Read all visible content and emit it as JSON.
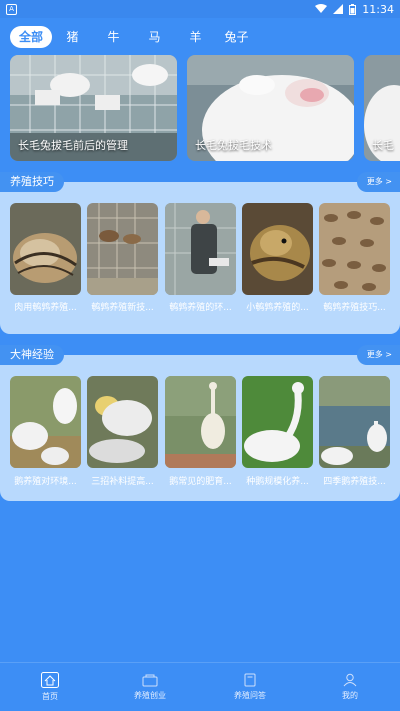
{
  "status": {
    "time": "11:34",
    "app_icon": "A"
  },
  "categories": [
    "全部",
    "猪",
    "牛",
    "马",
    "羊",
    "兔子"
  ],
  "banners": [
    {
      "caption": "长毛兔拔毛前后的管理"
    },
    {
      "caption": "长毛兔拔毛技术"
    },
    {
      "caption": "长毛"
    }
  ],
  "section1": {
    "title": "养殖技巧",
    "more": "更多 >",
    "items": [
      "肉用鹌鹑养殖...",
      "鹌鹑养殖新技...",
      "鹌鹑养殖的环...",
      "小鹌鹑养殖的...",
      "鹌鹑养殖技巧..."
    ]
  },
  "section2": {
    "title": "大神经验",
    "more": "更多 >",
    "items": [
      "鹅养殖对环境...",
      "三招补料提高...",
      "鹅常见的肥育...",
      "种鹅规模化养...",
      "四季鹅养殖技..."
    ]
  },
  "tabs": [
    {
      "label": "首页"
    },
    {
      "label": "养殖创业"
    },
    {
      "label": "养殖问答"
    },
    {
      "label": "我的"
    }
  ],
  "colors": {
    "primary": "#3d8ef5",
    "panel": "#b8d9fd"
  }
}
